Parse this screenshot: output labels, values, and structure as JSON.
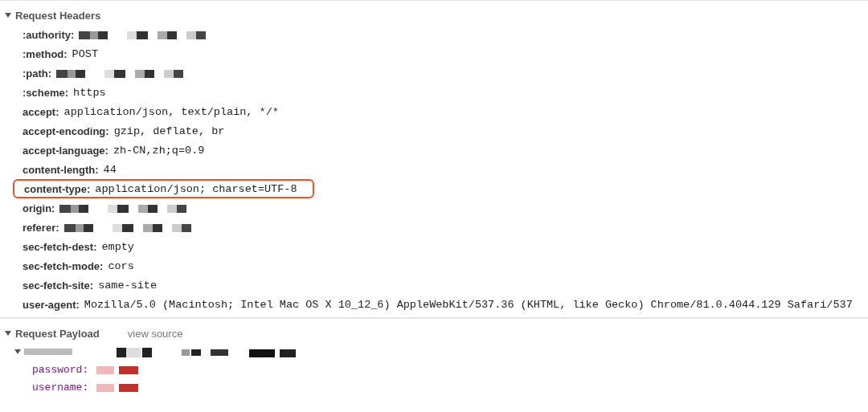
{
  "request_headers": {
    "title": "Request Headers",
    "expanded": true,
    "headers": [
      {
        "name": ":authority:",
        "kind": "redacted",
        "highlighted": false
      },
      {
        "name": ":method:",
        "kind": "text",
        "value": "POST",
        "highlighted": false
      },
      {
        "name": ":path:",
        "kind": "redacted",
        "highlighted": false
      },
      {
        "name": ":scheme:",
        "kind": "text",
        "value": "https",
        "highlighted": false
      },
      {
        "name": "accept:",
        "kind": "text",
        "value": "application/json, text/plain, */*",
        "highlighted": false
      },
      {
        "name": "accept-encoding:",
        "kind": "text",
        "value": "gzip, deflate, br",
        "highlighted": false
      },
      {
        "name": "accept-language:",
        "kind": "text",
        "value": "zh-CN,zh;q=0.9",
        "highlighted": false
      },
      {
        "name": "content-length:",
        "kind": "text",
        "value": "44",
        "highlighted": false
      },
      {
        "name": "content-type:",
        "kind": "text",
        "value": "application/json; charset=UTF-8",
        "highlighted": true
      },
      {
        "name": "origin:",
        "kind": "redacted",
        "highlighted": false
      },
      {
        "name": "referer:",
        "kind": "redacted",
        "highlighted": false
      },
      {
        "name": "sec-fetch-dest:",
        "kind": "text",
        "value": "empty",
        "highlighted": false
      },
      {
        "name": "sec-fetch-mode:",
        "kind": "text",
        "value": "cors",
        "highlighted": false
      },
      {
        "name": "sec-fetch-site:",
        "kind": "text",
        "value": "same-site",
        "highlighted": false
      },
      {
        "name": "user-agent:",
        "kind": "text",
        "value": "Mozilla/5.0 (Macintosh; Intel Mac OS X 10_12_6) AppleWebKit/537.36 (KHTML, like Gecko) Chrome/81.0.4044.129 Safari/537",
        "highlighted": false
      }
    ]
  },
  "request_payload": {
    "title": "Request Payload",
    "expanded": true,
    "view_source": "view source",
    "tree": [
      {
        "kind": "redacted",
        "expanded": true,
        "children": [
          {
            "key": "password:",
            "kind": "redacted"
          },
          {
            "key": "username:",
            "kind": "redacted"
          }
        ]
      }
    ]
  }
}
